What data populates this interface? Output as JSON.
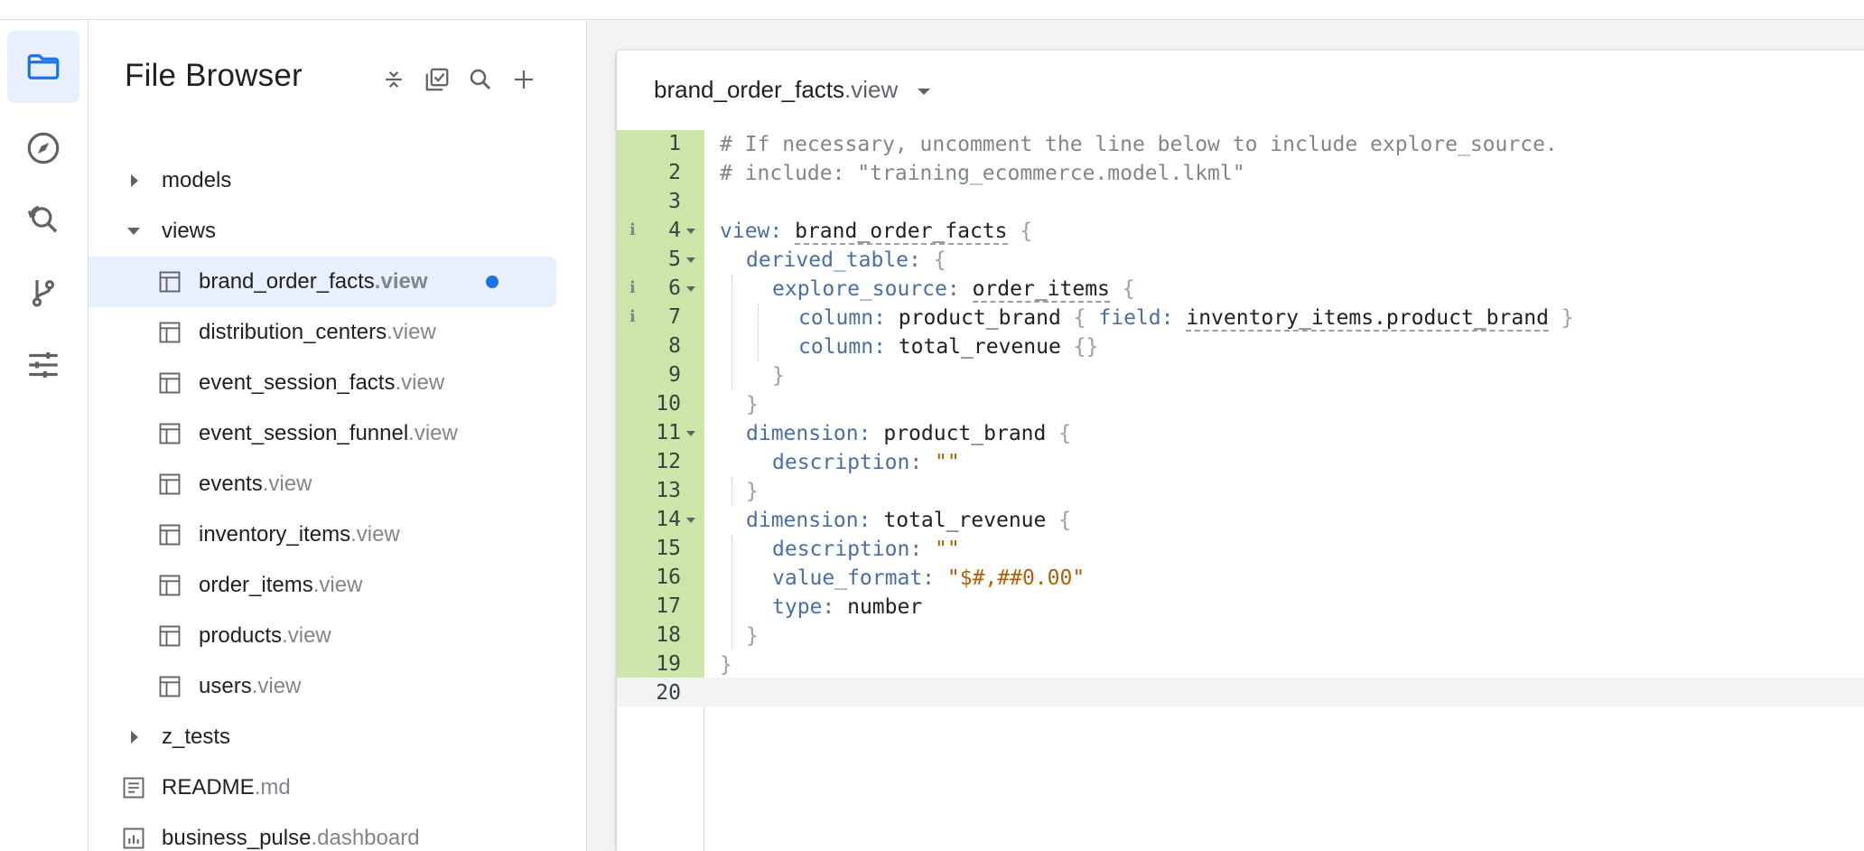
{
  "rail": {
    "items": [
      {
        "name": "folder-icon",
        "active": true
      },
      {
        "name": "compass-icon",
        "active": false
      },
      {
        "name": "search-replace-icon",
        "active": false
      },
      {
        "name": "git-branch-icon",
        "active": false
      },
      {
        "name": "sliders-icon",
        "active": false
      }
    ]
  },
  "browser": {
    "title": "File Browser",
    "tree": [
      {
        "type": "folder",
        "expanded": false,
        "name": "models",
        "ext": ""
      },
      {
        "type": "folder",
        "expanded": true,
        "name": "views",
        "ext": ""
      },
      {
        "type": "view",
        "name": "brand_order_facts",
        "ext": ".view",
        "selected": true,
        "unsaved": true
      },
      {
        "type": "view",
        "name": "distribution_centers",
        "ext": ".view"
      },
      {
        "type": "view",
        "name": "event_session_facts",
        "ext": ".view"
      },
      {
        "type": "view",
        "name": "event_session_funnel",
        "ext": ".view"
      },
      {
        "type": "view",
        "name": "events",
        "ext": ".view"
      },
      {
        "type": "view",
        "name": "inventory_items",
        "ext": ".view"
      },
      {
        "type": "view",
        "name": "order_items",
        "ext": ".view"
      },
      {
        "type": "view",
        "name": "products",
        "ext": ".view"
      },
      {
        "type": "view",
        "name": "users",
        "ext": ".view"
      },
      {
        "type": "folder",
        "expanded": false,
        "name": "z_tests",
        "ext": ""
      },
      {
        "type": "doc",
        "name": "README",
        "ext": ".md"
      },
      {
        "type": "dashboard",
        "name": "business_pulse",
        "ext": ".dashboard"
      }
    ]
  },
  "editor": {
    "tab_name": "brand_order_facts",
    "tab_ext": ".view",
    "line_numbers": [
      "1",
      "2",
      "3",
      "4",
      "5",
      "6",
      "7",
      "8",
      "9",
      "10",
      "11",
      "12",
      "13",
      "14",
      "15",
      "16",
      "17",
      "18",
      "19",
      "20"
    ],
    "info_lines": [
      4,
      6,
      7
    ],
    "fold_lines": [
      4,
      5,
      6,
      11,
      14
    ],
    "code": {
      "l1": "# If necessary, uncomment the line below to include explore_source.",
      "l2": "# include: \"training_ecommerce.model.lkml\"",
      "l4_key": "view:",
      "l4_val": "brand_order_facts",
      "l5_key": "derived_table:",
      "l6_key": "explore_source:",
      "l6_val": "order_items",
      "l7_key": "column:",
      "l7_val": "product_brand",
      "l7_key2": "field:",
      "l7_val2": "inventory_items.product_brand",
      "l8_key": "column:",
      "l8_val": "total_revenue",
      "l11_key": "dimension:",
      "l11_val": "product_brand",
      "l12_key": "description:",
      "l12_str": "\"\"",
      "l14_key": "dimension:",
      "l14_val": "total_revenue",
      "l15_key": "description:",
      "l15_str": "\"\"",
      "l16_key": "value_format:",
      "l16_str": "\"$#,##0.00\"",
      "l17_key": "type:",
      "l17_val": "number"
    }
  },
  "colors": {
    "accent": "#1a73e8",
    "selected_bg": "#e8f0fe",
    "gutter_changed": "#cce5a8"
  }
}
